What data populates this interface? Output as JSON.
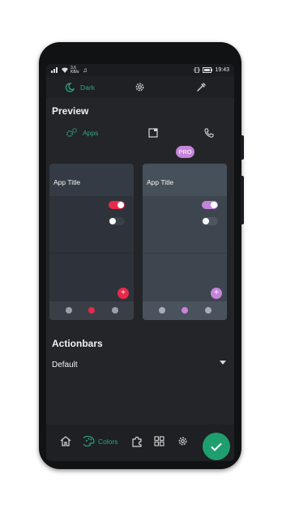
{
  "status_bar": {
    "network": "3.6 KB/s",
    "time": "19:43"
  },
  "toolbar": {
    "theme_label": "Dark"
  },
  "preview": {
    "title": "Preview",
    "tab_apps_label": "Apps",
    "pro_badge": "PRO",
    "cards": [
      {
        "app_title": "App Title",
        "accent": "#e8294a"
      },
      {
        "app_title": "App Title",
        "accent": "#c584d9"
      }
    ]
  },
  "actionbars": {
    "title": "Actionbars",
    "selected": "Default"
  },
  "bottom_nav": {
    "colors_label": "Colors"
  },
  "colors": {
    "accent": "#2aa87a",
    "fab": "#1f9f6f",
    "pro": "#c584d9",
    "red": "#e8294a"
  }
}
